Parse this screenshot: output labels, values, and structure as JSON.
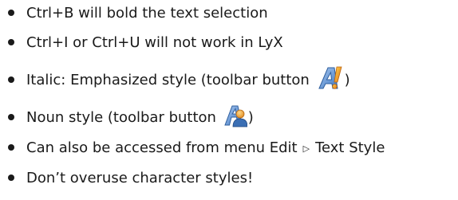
{
  "slide": {
    "items": [
      {
        "text": "Ctrl+B will bold the text selection"
      },
      {
        "text": "Ctrl+I or Ctrl+U will not work in LyX"
      },
      {
        "before": "Italic: Emphasized style (toolbar button ",
        "after": ")",
        "icon": "emphasize-icon"
      },
      {
        "before": "Noun style (toolbar button ",
        "after": ")",
        "icon": "noun-icon"
      },
      {
        "before": "Can also be accessed from menu Edit",
        "separator": "▷",
        "after": "Text Style"
      },
      {
        "text": "Don’t overuse character styles!"
      }
    ]
  },
  "colors": {
    "text": "#1a1a1a",
    "icon_blue": "#4f86c9",
    "icon_orange": "#f0901c",
    "icon_avatar_body": "#3b6fb4",
    "icon_avatar_head": "#e8a33a"
  }
}
